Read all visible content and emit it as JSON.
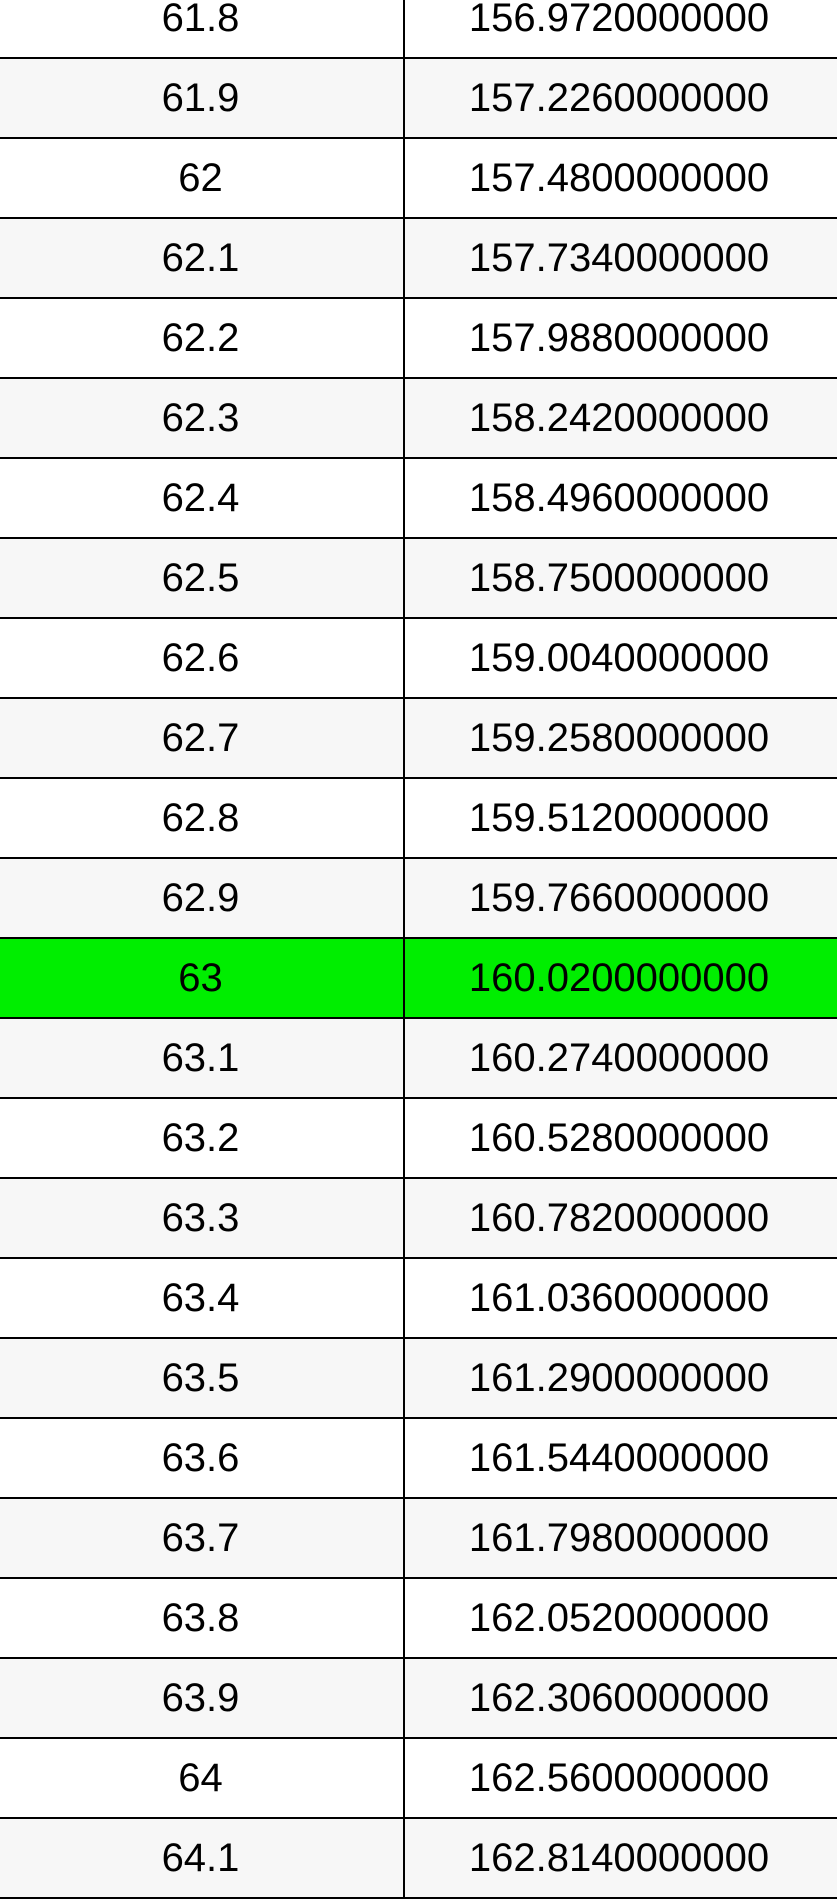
{
  "colors": {
    "highlight": "#00ee00",
    "row_alt": "#f7f7f7",
    "row": "#ffffff",
    "border": "#000000"
  },
  "rows": [
    {
      "from": "61.8",
      "to": "156.9720000000",
      "highlight": false
    },
    {
      "from": "61.9",
      "to": "157.2260000000",
      "highlight": false
    },
    {
      "from": "62",
      "to": "157.4800000000",
      "highlight": false
    },
    {
      "from": "62.1",
      "to": "157.7340000000",
      "highlight": false
    },
    {
      "from": "62.2",
      "to": "157.9880000000",
      "highlight": false
    },
    {
      "from": "62.3",
      "to": "158.2420000000",
      "highlight": false
    },
    {
      "from": "62.4",
      "to": "158.4960000000",
      "highlight": false
    },
    {
      "from": "62.5",
      "to": "158.7500000000",
      "highlight": false
    },
    {
      "from": "62.6",
      "to": "159.0040000000",
      "highlight": false
    },
    {
      "from": "62.7",
      "to": "159.2580000000",
      "highlight": false
    },
    {
      "from": "62.8",
      "to": "159.5120000000",
      "highlight": false
    },
    {
      "from": "62.9",
      "to": "159.7660000000",
      "highlight": false
    },
    {
      "from": "63",
      "to": "160.0200000000",
      "highlight": true
    },
    {
      "from": "63.1",
      "to": "160.2740000000",
      "highlight": false
    },
    {
      "from": "63.2",
      "to": "160.5280000000",
      "highlight": false
    },
    {
      "from": "63.3",
      "to": "160.7820000000",
      "highlight": false
    },
    {
      "from": "63.4",
      "to": "161.0360000000",
      "highlight": false
    },
    {
      "from": "63.5",
      "to": "161.2900000000",
      "highlight": false
    },
    {
      "from": "63.6",
      "to": "161.5440000000",
      "highlight": false
    },
    {
      "from": "63.7",
      "to": "161.7980000000",
      "highlight": false
    },
    {
      "from": "63.8",
      "to": "162.0520000000",
      "highlight": false
    },
    {
      "from": "63.9",
      "to": "162.3060000000",
      "highlight": false
    },
    {
      "from": "64",
      "to": "162.5600000000",
      "highlight": false
    },
    {
      "from": "64.1",
      "to": "162.8140000000",
      "highlight": false
    }
  ]
}
